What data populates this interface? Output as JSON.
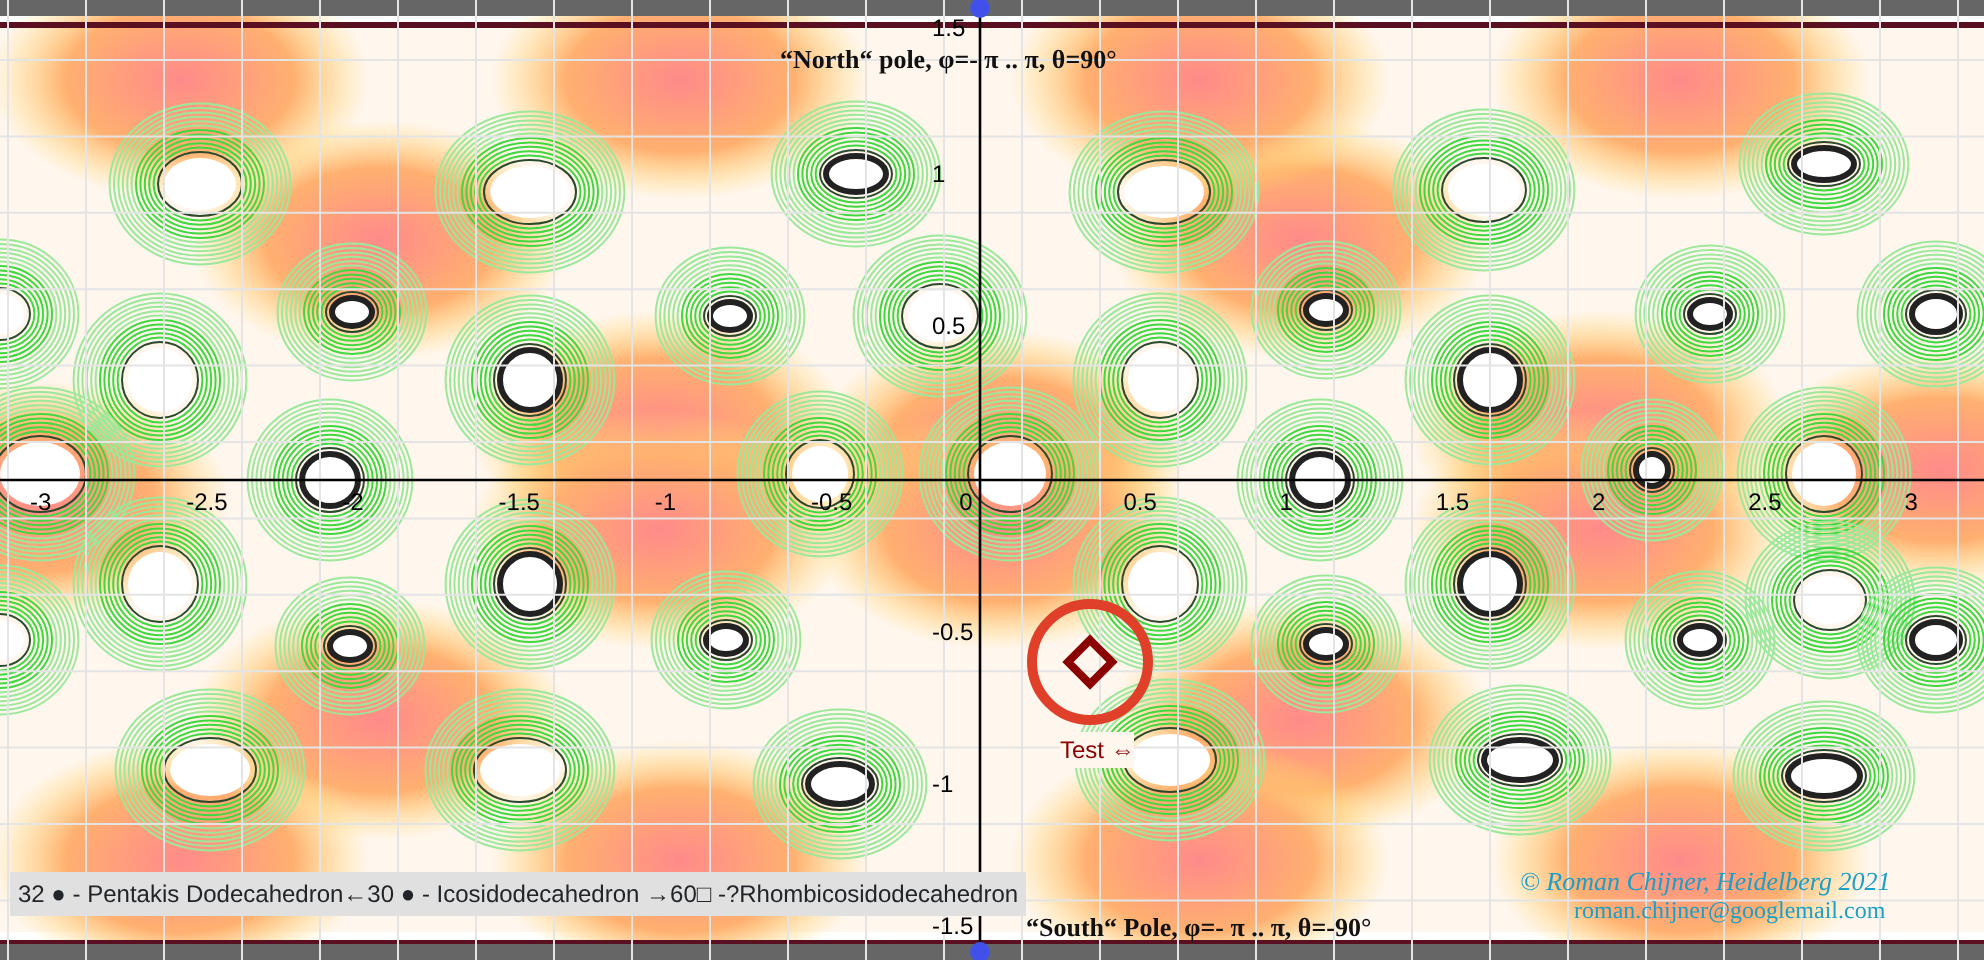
{
  "plot": {
    "top_title": "“North“ pole, φ=- π .. π, θ=90°",
    "bottom_title": "“South“ Pole, φ=- π .. π, θ=-90°",
    "x_ticks": [
      "-3",
      "-2.5",
      "-2",
      "-1.5",
      "-1",
      "-0.5",
      "0",
      "0.5",
      "1",
      "1.5",
      "2",
      "2.5",
      "3"
    ],
    "y_ticks": [
      "1.5",
      "1",
      "0.5",
      "-0.5",
      "-1",
      "-1.5"
    ],
    "marker": {
      "label": "Test ⇔"
    }
  },
  "legend": "32 ● - Pentakis Dodecahedron←30 ● - Icosidodecahedron →60□  -?Rhombicosidodecahedron",
  "credit": {
    "author": "©  Roman Chijner, Heidelberg 2021",
    "email": "roman.chijner@googlemail.com"
  }
}
